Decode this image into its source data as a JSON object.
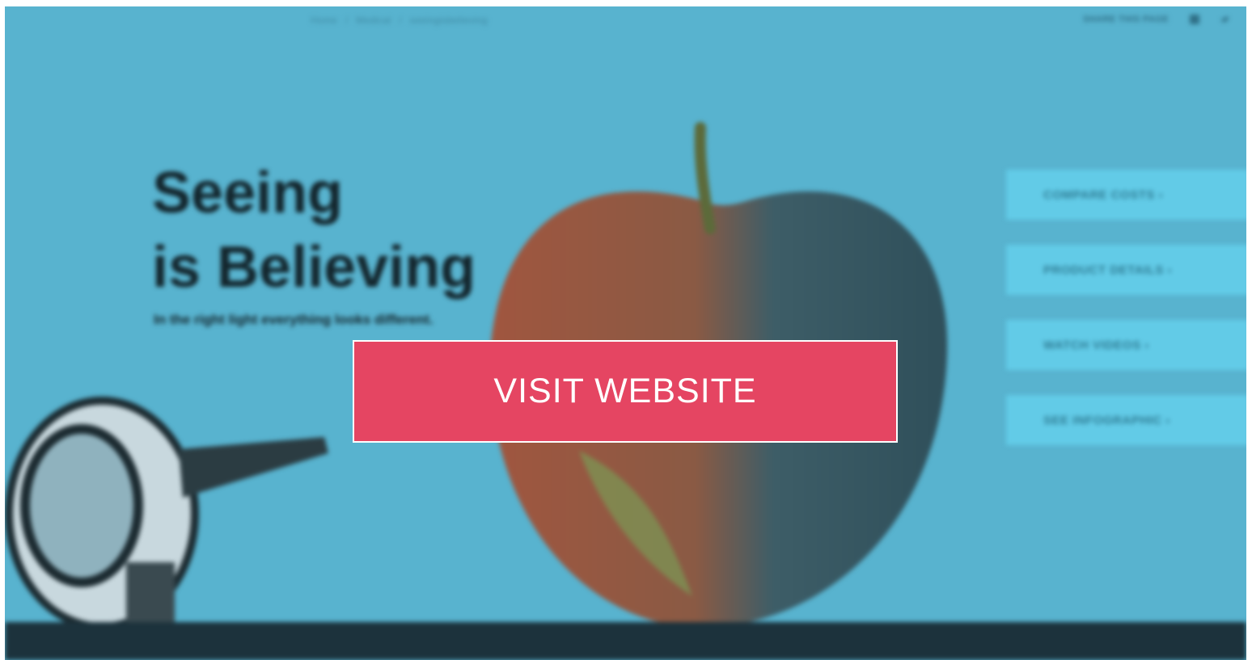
{
  "breadcrumb": {
    "items": [
      "Home",
      "/",
      "Medical",
      "/",
      "seeingisbelieving"
    ]
  },
  "topbar": {
    "share_label": "SHARE THIS PAGE",
    "icons": [
      "linkedin-icon",
      "twitter-icon"
    ]
  },
  "hero": {
    "title_line1": "Seeing",
    "title_line2": "is Believing",
    "subtitle": "In the right light everything looks different."
  },
  "side_nav": {
    "items": [
      {
        "label": "COMPARE COSTS ›"
      },
      {
        "label": "PRODUCT DETAILS ›"
      },
      {
        "label": "WATCH VIDEOS ›"
      },
      {
        "label": "SEE INFOGRAPHIC ›"
      }
    ]
  },
  "cta": {
    "label": "VISIT WEBSITE"
  },
  "colors": {
    "background": "#58b3cf",
    "cta": "#e54562",
    "side_nav": "#62cbe7",
    "footer": "#1c323c"
  }
}
